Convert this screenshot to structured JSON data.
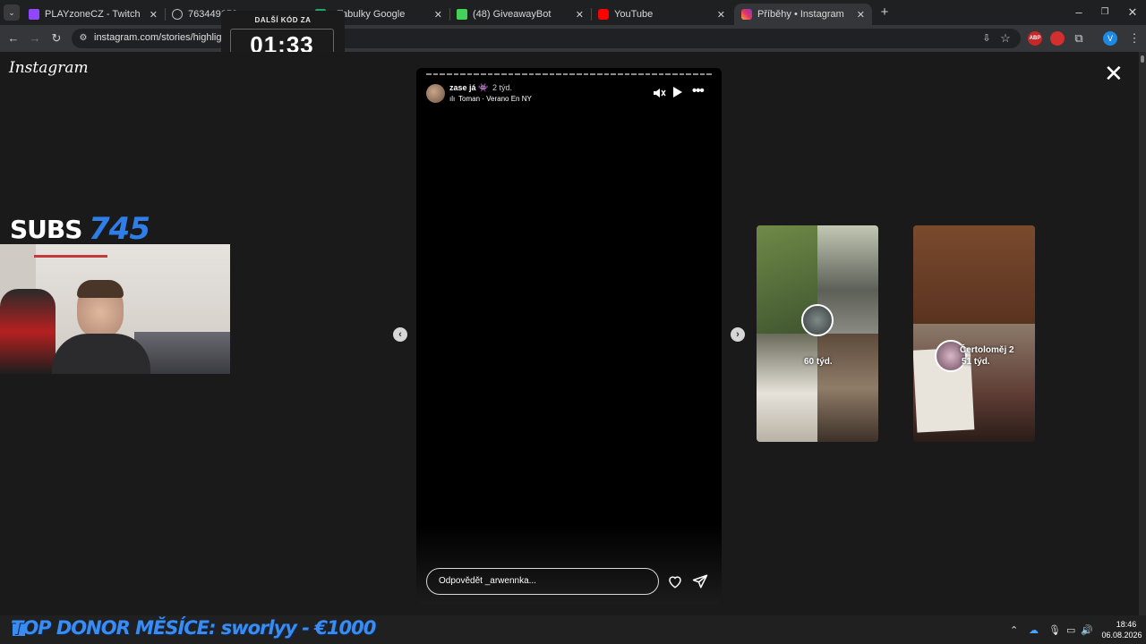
{
  "browser": {
    "tabs": [
      {
        "label": "PLAYzoneCZ - Twitch",
        "favicon_color": "#9146ff"
      },
      {
        "label": "763449653",
        "favicon_color": "#bdbdbd"
      },
      {
        "label": "- Tabulky Google",
        "favicon_color": "#23a566"
      },
      {
        "label": "(48) GiveawayBot",
        "favicon_color": "#43d15a"
      },
      {
        "label": "YouTube",
        "favicon_color": "#ff0000"
      },
      {
        "label": "Příběhy • Instagram",
        "favicon_color": "#e1306c",
        "active": true
      }
    ],
    "url": "instagram.com/stories/highlights/"
  },
  "overlay": {
    "timer_title": "DALŠÍ KÓD ZA",
    "timer_value": "01:33",
    "subs_label": "SUBS",
    "subs_count": "745",
    "donor_ticker": "TOP DONOR MĚSÍCE: sworlyy - €1000"
  },
  "instagram": {
    "logo": "Instagram",
    "story": {
      "username": "zase já",
      "emoji": "👾",
      "time": "2 týd.",
      "music_icon": "music-bars-icon",
      "music": "Toman · Verano En NY",
      "reply_placeholder": "Odpovědět _arwennka...",
      "progress_segments": 42,
      "progress_done": 0
    },
    "previews": [
      {
        "name": "",
        "time": "60 týd."
      },
      {
        "name": "Čertoloměj 2",
        "time": "51 týd."
      }
    ]
  },
  "taskbar": {
    "time": "18:46",
    "date": "06.08.2026"
  }
}
